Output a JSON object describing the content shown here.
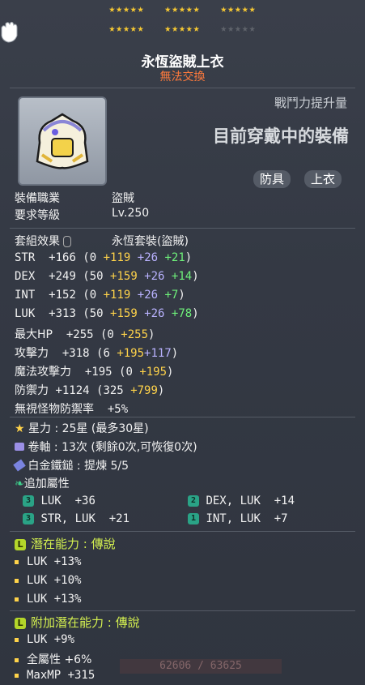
{
  "stars": {
    "row1": [
      "★★★★★",
      "★★★★★",
      "★★★★★"
    ],
    "row2_lit": [
      "★★★★★",
      "★★★★★"
    ],
    "row2_dim": "★★★★★"
  },
  "item": {
    "name": "永恆盜賊上衣",
    "trade_status": "無法交換"
  },
  "header": {
    "combat_label": "戰鬥力提升量",
    "equipped_label": "目前穿戴中的裝備"
  },
  "tags": [
    "防具",
    "上衣"
  ],
  "requirements": {
    "job_label": "裝備職業",
    "job_value": "盜賊",
    "level_label": "要求等級",
    "level_value": "Lv.250"
  },
  "set_effect": {
    "label": "套組效果",
    "value": "永恆套裝(盜賊)"
  },
  "stats": [
    {
      "name": "STR",
      "total": "+166",
      "base": "0",
      "star": "+119",
      "scroll": "+26",
      "flame": "+21"
    },
    {
      "name": "DEX",
      "total": "+249",
      "base": "50",
      "star": "+159",
      "scroll": "+26",
      "flame": "+14"
    },
    {
      "name": "INT",
      "total": "+152",
      "base": "0",
      "star": "+119",
      "scroll": "+26",
      "flame": "+7"
    },
    {
      "name": "LUK",
      "total": "+313",
      "base": "50",
      "star": "+159",
      "scroll": "+26",
      "flame": "+78"
    }
  ],
  "stats2": {
    "maxhp": {
      "name": "最大HP",
      "total": "+255",
      "base": "0",
      "star": "+255"
    },
    "att": {
      "name": "攻擊力",
      "total": "+318",
      "base": "6",
      "star": "+195",
      "scroll": "+117"
    },
    "matt": {
      "name": "魔法攻擊力",
      "total": "+195",
      "base": "0",
      "star": "+195"
    },
    "def": {
      "name": "防禦力",
      "total": "+1124",
      "base": "325",
      "star": "+799"
    },
    "ied": {
      "name": "無視怪物防禦率",
      "total": "+5%"
    }
  },
  "enhance": {
    "star": {
      "label": "星力",
      "value": "25星 (最多30星)"
    },
    "scroll": {
      "label": "卷軸",
      "value": "13次 (剩餘0次,可恢復0次)"
    },
    "hammer": {
      "label": "白金鐵鎚",
      "value": "提煉 5/5"
    }
  },
  "additional": {
    "label": "追加屬性",
    "items": [
      {
        "tier": "3",
        "text": "LUK  +36"
      },
      {
        "tier": "2",
        "text": "DEX, LUK  +14"
      },
      {
        "tier": "3",
        "text": "STR, LUK  +21"
      },
      {
        "tier": "1",
        "text": "INT, LUK  +7"
      }
    ]
  },
  "potential": {
    "title": "潛在能力 : 傳說",
    "lines": [
      "LUK +13%",
      "LUK +10%",
      "LUK +13%"
    ]
  },
  "bonus_potential": {
    "title": "附加潛在能力 : 傳說",
    "lines": [
      "LUK +9%",
      "全屬性 +6%",
      "MaxMP +315"
    ]
  },
  "hp_bar": "62606 / 63625",
  "colors": {
    "star": "#ffd34a",
    "scroll": "#b9b2ff",
    "flame": "#6ef07a",
    "trade": "#ff7a3c",
    "potential": "#d4f050"
  }
}
